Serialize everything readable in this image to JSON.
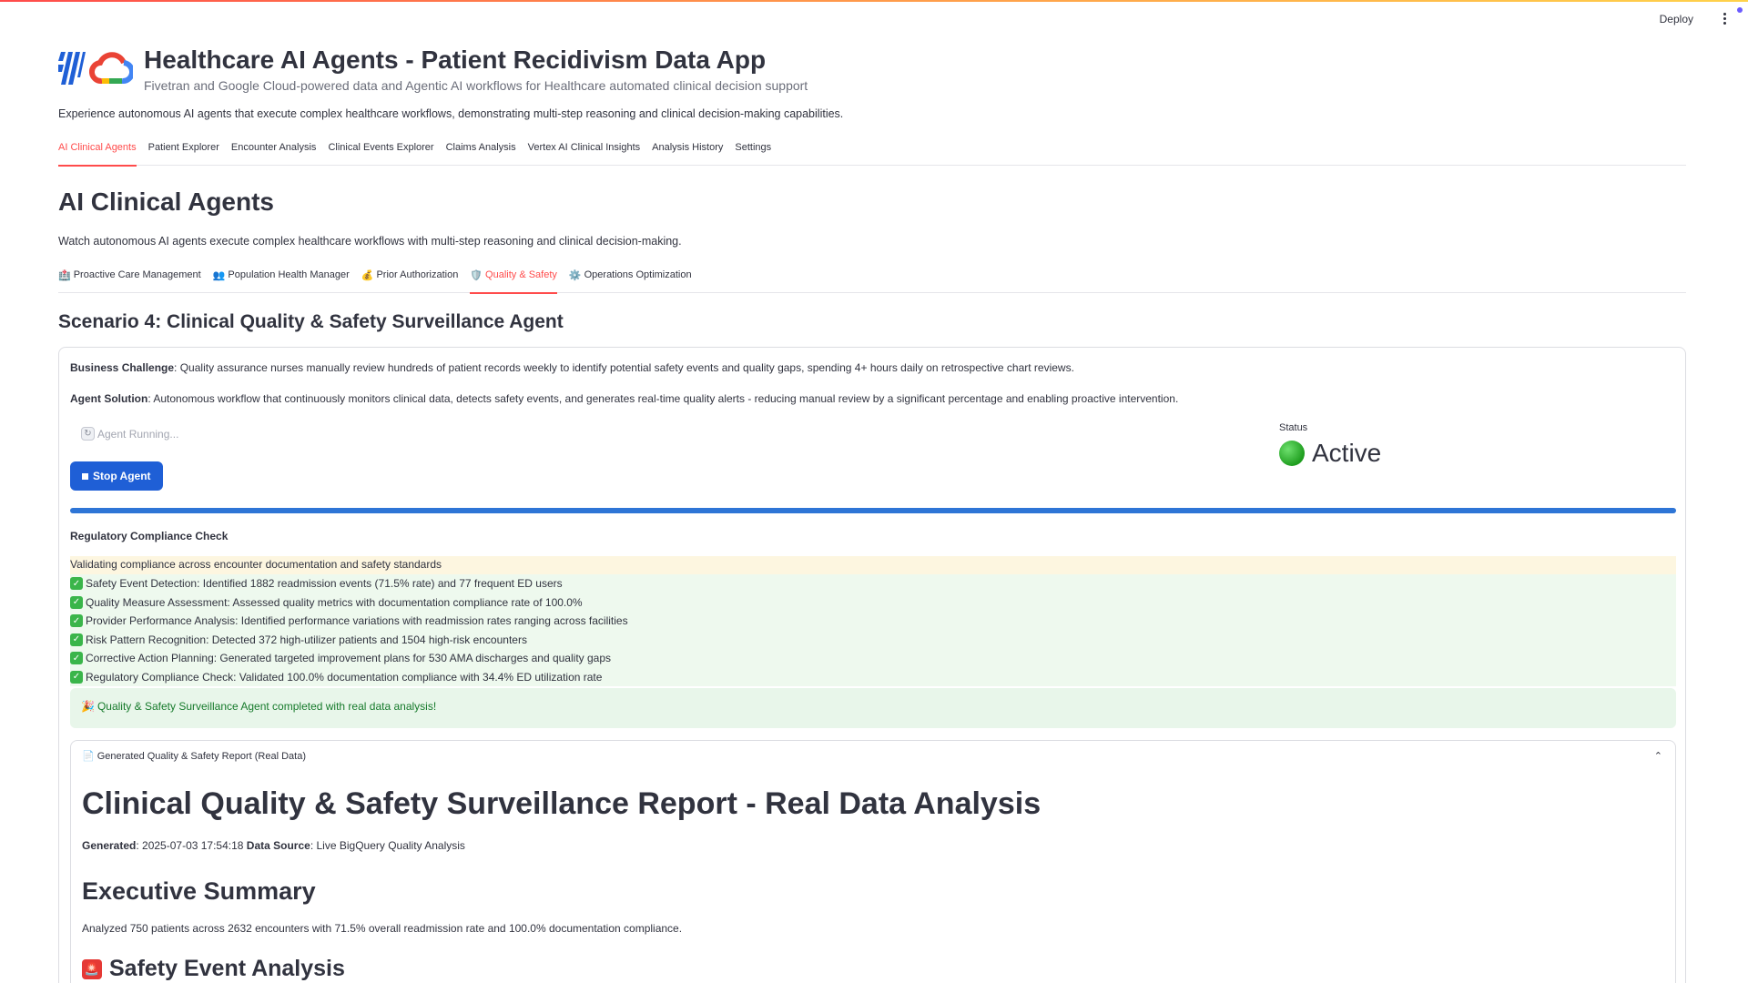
{
  "topbar": {
    "deploy_label": "Deploy"
  },
  "app": {
    "title": "Healthcare AI Agents - Patient Recidivism Data App",
    "subtitle": "Fivetran and Google Cloud-powered data and Agentic AI workflows for Healthcare automated clinical decision support",
    "intro": "Experience autonomous AI agents that execute complex healthcare workflows, demonstrating multi-step reasoning and clinical decision-making capabilities."
  },
  "main_tabs": [
    {
      "label": "AI Clinical Agents",
      "active": true
    },
    {
      "label": "Patient Explorer"
    },
    {
      "label": "Encounter Analysis"
    },
    {
      "label": "Clinical Events Explorer"
    },
    {
      "label": "Claims Analysis"
    },
    {
      "label": "Vertex AI Clinical Insights"
    },
    {
      "label": "Analysis History"
    },
    {
      "label": "Settings"
    }
  ],
  "section": {
    "title": "AI Clinical Agents",
    "description": "Watch autonomous AI agents execute complex healthcare workflows with multi-step reasoning and clinical decision-making."
  },
  "sub_tabs": [
    {
      "icon": "🏥",
      "label": "Proactive Care Management"
    },
    {
      "icon": "👥",
      "label": "Population Health Manager"
    },
    {
      "icon": "💰",
      "label": "Prior Authorization"
    },
    {
      "icon": "🛡️",
      "label": "Quality & Safety",
      "active": true
    },
    {
      "icon": "⚙️",
      "label": "Operations Optimization"
    }
  ],
  "scenario": {
    "title": "Scenario 4: Clinical Quality & Safety Surveillance Agent",
    "challenge_label": "Business Challenge",
    "challenge_text": ": Quality assurance nurses manually review hundreds of patient records weekly to identify potential safety events and quality gaps, spending 4+ hours daily on retrospective chart reviews.",
    "solution_label": "Agent Solution",
    "solution_text": ": Autonomous workflow that continuously monitors clinical data, detects safety events, and generates real-time quality alerts - reducing manual review by a significant percentage and enabling proactive intervention."
  },
  "agent": {
    "running_label": "Agent Running...",
    "stop_label": "Stop Agent",
    "status_label": "Status",
    "status_value": "Active",
    "progress": 1.0,
    "step_title": "Regulatory Compliance Check",
    "working_text": "Validating compliance across encounter documentation and safety standards",
    "steps": [
      "Safety Event Detection: Identified 1882 readmission events (71.5% rate) and 77 frequent ED users",
      "Quality Measure Assessment: Assessed quality metrics with documentation compliance rate of 100.0%",
      "Provider Performance Analysis: Identified performance variations with readmission rates ranging across facilities",
      "Risk Pattern Recognition: Detected 372 high-utilizer patients and 1504 high-risk encounters",
      "Corrective Action Planning: Generated targeted improvement plans for 530 AMA discharges and quality gaps",
      "Regulatory Compliance Check: Validated 100.0% documentation compliance with 34.4% ED utilization rate"
    ],
    "complete_text": "Quality & Safety Surveillance Agent completed with real data analysis!"
  },
  "report": {
    "expander_label": "Generated Quality & Safety Report (Real Data)",
    "title": "Clinical Quality & Safety Surveillance Report - Real Data Analysis",
    "generated_label": "Generated",
    "generated_value": ": 2025-07-03 17:54:18 ",
    "source_label": "Data Source",
    "source_value": ": Live BigQuery Quality Analysis",
    "summary_heading": "Executive Summary",
    "summary_text": "Analyzed 750 patients across 2632 encounters with 71.5% overall readmission rate and 100.0% documentation compliance.",
    "safety_heading": "Safety Event Analysis"
  },
  "colors": {
    "accent": "#ff4b4b",
    "primary_button": "#1f5fd6",
    "progress": "#2e75d6",
    "success_bg": "#eef9ee",
    "warning_bg": "#fdf6e0"
  }
}
